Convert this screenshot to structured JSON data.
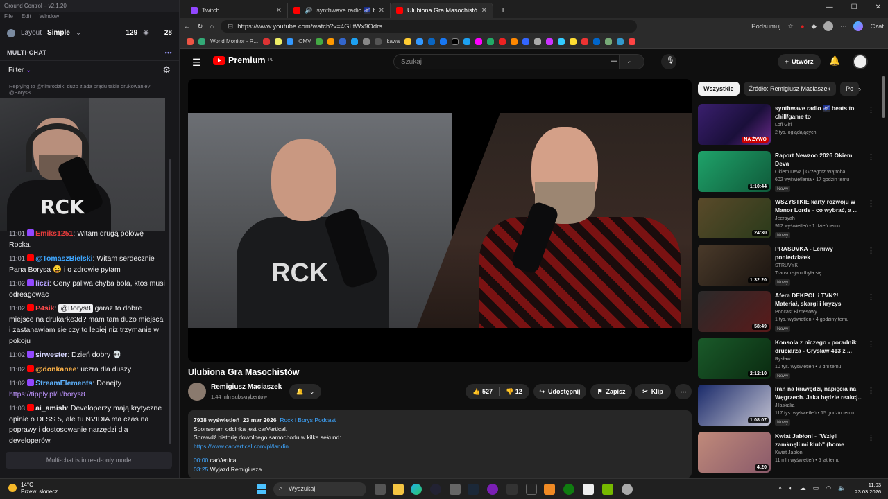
{
  "groundcontrol": {
    "title": "Ground Control – v2.1.20",
    "menu": [
      "File",
      "Edit",
      "Window"
    ],
    "layout_label": "Layout",
    "layout_value": "Simple",
    "viewers": "129",
    "count2": "28",
    "multichat_title": "MULTI-CHAT",
    "filter_label": "Filter",
    "reply_text": "Replying to @nimrodzik: dużo zjada prądu takie drukowanie? @Borys8",
    "readonly_text": "Multi-chat is in read-only mode",
    "messages": [
      {
        "time": "11:01",
        "nick": "Emiks1251",
        "nick_color": "#e63b3b",
        "text": "Witam drugą połowę Rocka."
      },
      {
        "time": "11:01",
        "nick": "@TomaszBielski",
        "nick_color": "#3ea6ff",
        "text": "Witam serdecznie Pana Borysa 😀 i o zdrowie pytam"
      },
      {
        "time": "11:02",
        "nick": "liczi",
        "nick_color": "#b7a3ff",
        "text": "Ceny paliwa chyba bola, ktos musi odreagowac"
      },
      {
        "time": "11:02",
        "nick": "P4sik",
        "nick_color": "#ff4d4d",
        "mention": "@Borys8",
        "text": "garaz to dobre miejsce na drukarke3d? mam tam duzo miejsca i zastanawiam sie czy to lepiej niz trzymanie w pokoju"
      },
      {
        "time": "11:02",
        "nick": "sirwester",
        "nick_color": "#d6d6ff",
        "text": "Dzień dobry 💀"
      },
      {
        "time": "11:02",
        "nick": "@donkanee",
        "nick_color": "#ffb347",
        "text": "uczra dla duszy"
      },
      {
        "time": "11:02",
        "nick": "StreamElements",
        "nick_color": "#5fb3ff",
        "text": "Donejty",
        "link": "https://tipply.pl/u/borys8"
      },
      {
        "time": "11:03",
        "nick": "ai_amish",
        "nick_color": "#efeff1",
        "text": "Developerzy mają krytyczne opinie o DLSS 5, ale tu NVIDIA ma czas na poprawy i dostosowanie narzędzi dla developerów."
      }
    ]
  },
  "browser": {
    "tabs": [
      {
        "label": "Twitch",
        "color": "#9147ff"
      },
      {
        "label": "synthwave radio 🌌 beats to",
        "color": "#ff0000"
      },
      {
        "label": "Ulubiona Gra Masochistów - YouTu",
        "color": "#ff0000"
      }
    ],
    "url": "https://www.youtube.com/watch?v=4GLtWx9Odrs",
    "summary_label": "Podsumuj",
    "copilot_label": "Czat",
    "bookmarks": [
      "World Monitor - R...",
      "OMV",
      "kawa"
    ]
  },
  "youtube": {
    "logo": "Premium",
    "region": "PL",
    "search_placeholder": "Szukaj",
    "create_label": "Utwórz",
    "video_title": "Ulubiona Gra Masochistów",
    "channel_name": "Remigiusz Maciaszek",
    "channel_subs": "1,44 mln subskrybentów",
    "likes": "527",
    "dislikes": "12",
    "share_label": "Udostępnij",
    "save_label": "Zapisz",
    "clip_label": "Klip",
    "desc": {
      "views": "7938 wyświetleń",
      "date": "23 mar 2026",
      "tag": "Rock i Borys Podcast",
      "line1": "Sponsorem odcinka jest carVertical.",
      "line2": "Sprawdź historię dowolnego samochodu w kilka sekund:",
      "link": "https://www.carvertical.com/pl/landin...",
      "ch1_time": "00:00",
      "ch1_label": "carVertical",
      "ch2_time": "03:25",
      "ch2_label": "Wyjazd Remigiusza"
    },
    "chips": [
      "Wszystkie",
      "Źródło: Remigiusz Maciaszek",
      "Po"
    ],
    "recommended": [
      {
        "title": "synthwave radio 🌌 beats to chill/game to",
        "channel": "Lofi Girl",
        "meta": "2 tys. oglądających",
        "badge": "NA ŻYWO",
        "live": true,
        "new": "",
        "thumb": "linear-gradient(135deg,#3a1f6e,#1a0f3a 60%,#6a2a8a)"
      },
      {
        "title": "Raport Newzoo 2026 Okiem Deva",
        "channel": "Okiem Deva | Grzegorz Wątroba",
        "meta": "602 wyświetlenia • 17 godzin temu",
        "badge": "1:10:44",
        "live": false,
        "new": "Nowy",
        "thumb": "linear-gradient(135deg,#1fa36a,#0f5a3a)"
      },
      {
        "title": "WSZYSTKIE karty rozwoju w Manor Lords - co wybrać, a ...",
        "channel": "Jeerayah",
        "meta": "912 wyświetleń • 1 dzień temu",
        "badge": "24:30",
        "live": false,
        "new": "Nowy",
        "thumb": "linear-gradient(135deg,#5a4a2a,#2a3a1a)"
      },
      {
        "title": "PRASUVKA - Leniwy poniedziałek",
        "channel": "STRUVYK",
        "meta": "Transmisja odbyła się",
        "badge": "1:32:20",
        "live": false,
        "new": "Nowy",
        "thumb": "linear-gradient(135deg,#4a3a2a,#1a1410)"
      },
      {
        "title": "Afera DEKPOL i TVN?! Materiał, skargi i kryzys wizerunkowy? ...",
        "channel": "Podcast Biznesowy",
        "meta": "1 tys. wyświetleń • 4 godziny temu",
        "badge": "58:49",
        "live": false,
        "new": "Nowy",
        "thumb": "linear-gradient(135deg,#2a2a2a,#5a1a1a)"
      },
      {
        "title": "Konsola z niczego - poradnik druciarza - Grysław 413 z ...",
        "channel": "Rysław",
        "meta": "10 tys. wyświetleń • 2 dni temu",
        "badge": "2:12:10",
        "live": false,
        "new": "Nowy",
        "thumb": "linear-gradient(135deg,#1a5a2a,#0a2a10)"
      },
      {
        "title": "Iran na krawędzi, napięcia na Węgrzech. Jaka będzie reakcj...",
        "channel": "Jilaskalia",
        "meta": "117 tys. wyświetleń • 15 godzin temu",
        "badge": "1:08:07",
        "live": false,
        "new": "Nowy",
        "thumb": "linear-gradient(135deg,#1a2a6a,#c0c0d0)"
      },
      {
        "title": "Kwiat Jabłoni - \"Wzięli zamknęli mi klub\" (home edition)",
        "channel": "Kwiat Jabłoni",
        "meta": "11 mln wyświetleń • 5 lat temu",
        "badge": "4:20",
        "live": false,
        "new": "",
        "thumb": "linear-gradient(135deg,#c08a7a,#8a5a6a)"
      }
    ]
  },
  "taskbar": {
    "temp": "14°C",
    "weather": "Przew. słonecz.",
    "search_label": "Wyszukaj",
    "time": "11:03",
    "date": "23.03.2026"
  }
}
